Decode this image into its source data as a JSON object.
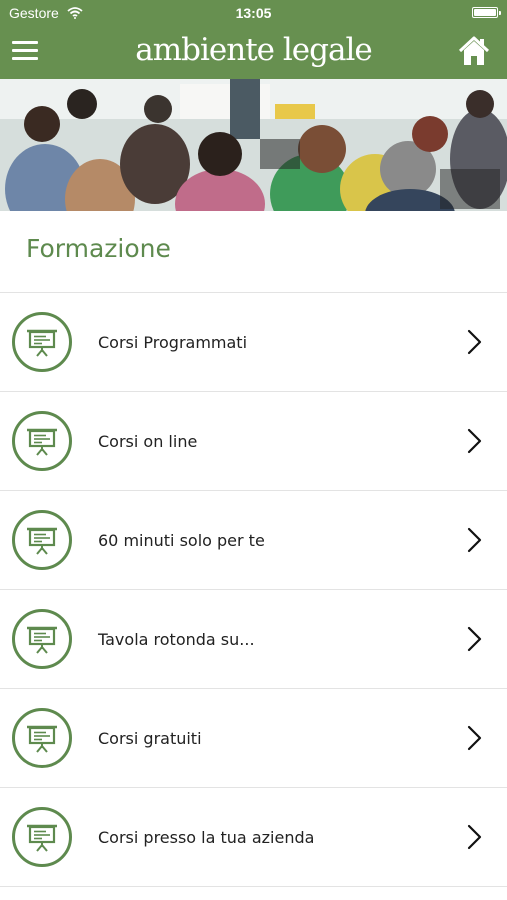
{
  "status_bar": {
    "carrier": "Gestore",
    "time": "13:05"
  },
  "header": {
    "title": "ambiente legale",
    "menu_icon": "hamburger-icon",
    "home_icon": "home-icon"
  },
  "section": {
    "title": "Formazione"
  },
  "items": [
    {
      "label": "Corsi Programmati"
    },
    {
      "label": "Corsi on line"
    },
    {
      "label": "60 minuti solo per te"
    },
    {
      "label": "Tavola rotonda su..."
    },
    {
      "label": "Corsi gratuiti"
    },
    {
      "label": "Corsi presso la tua azienda"
    }
  ],
  "colors": {
    "brand": "#679050",
    "accent_text": "#5e8a4e",
    "divider": "#e3e3e3"
  }
}
